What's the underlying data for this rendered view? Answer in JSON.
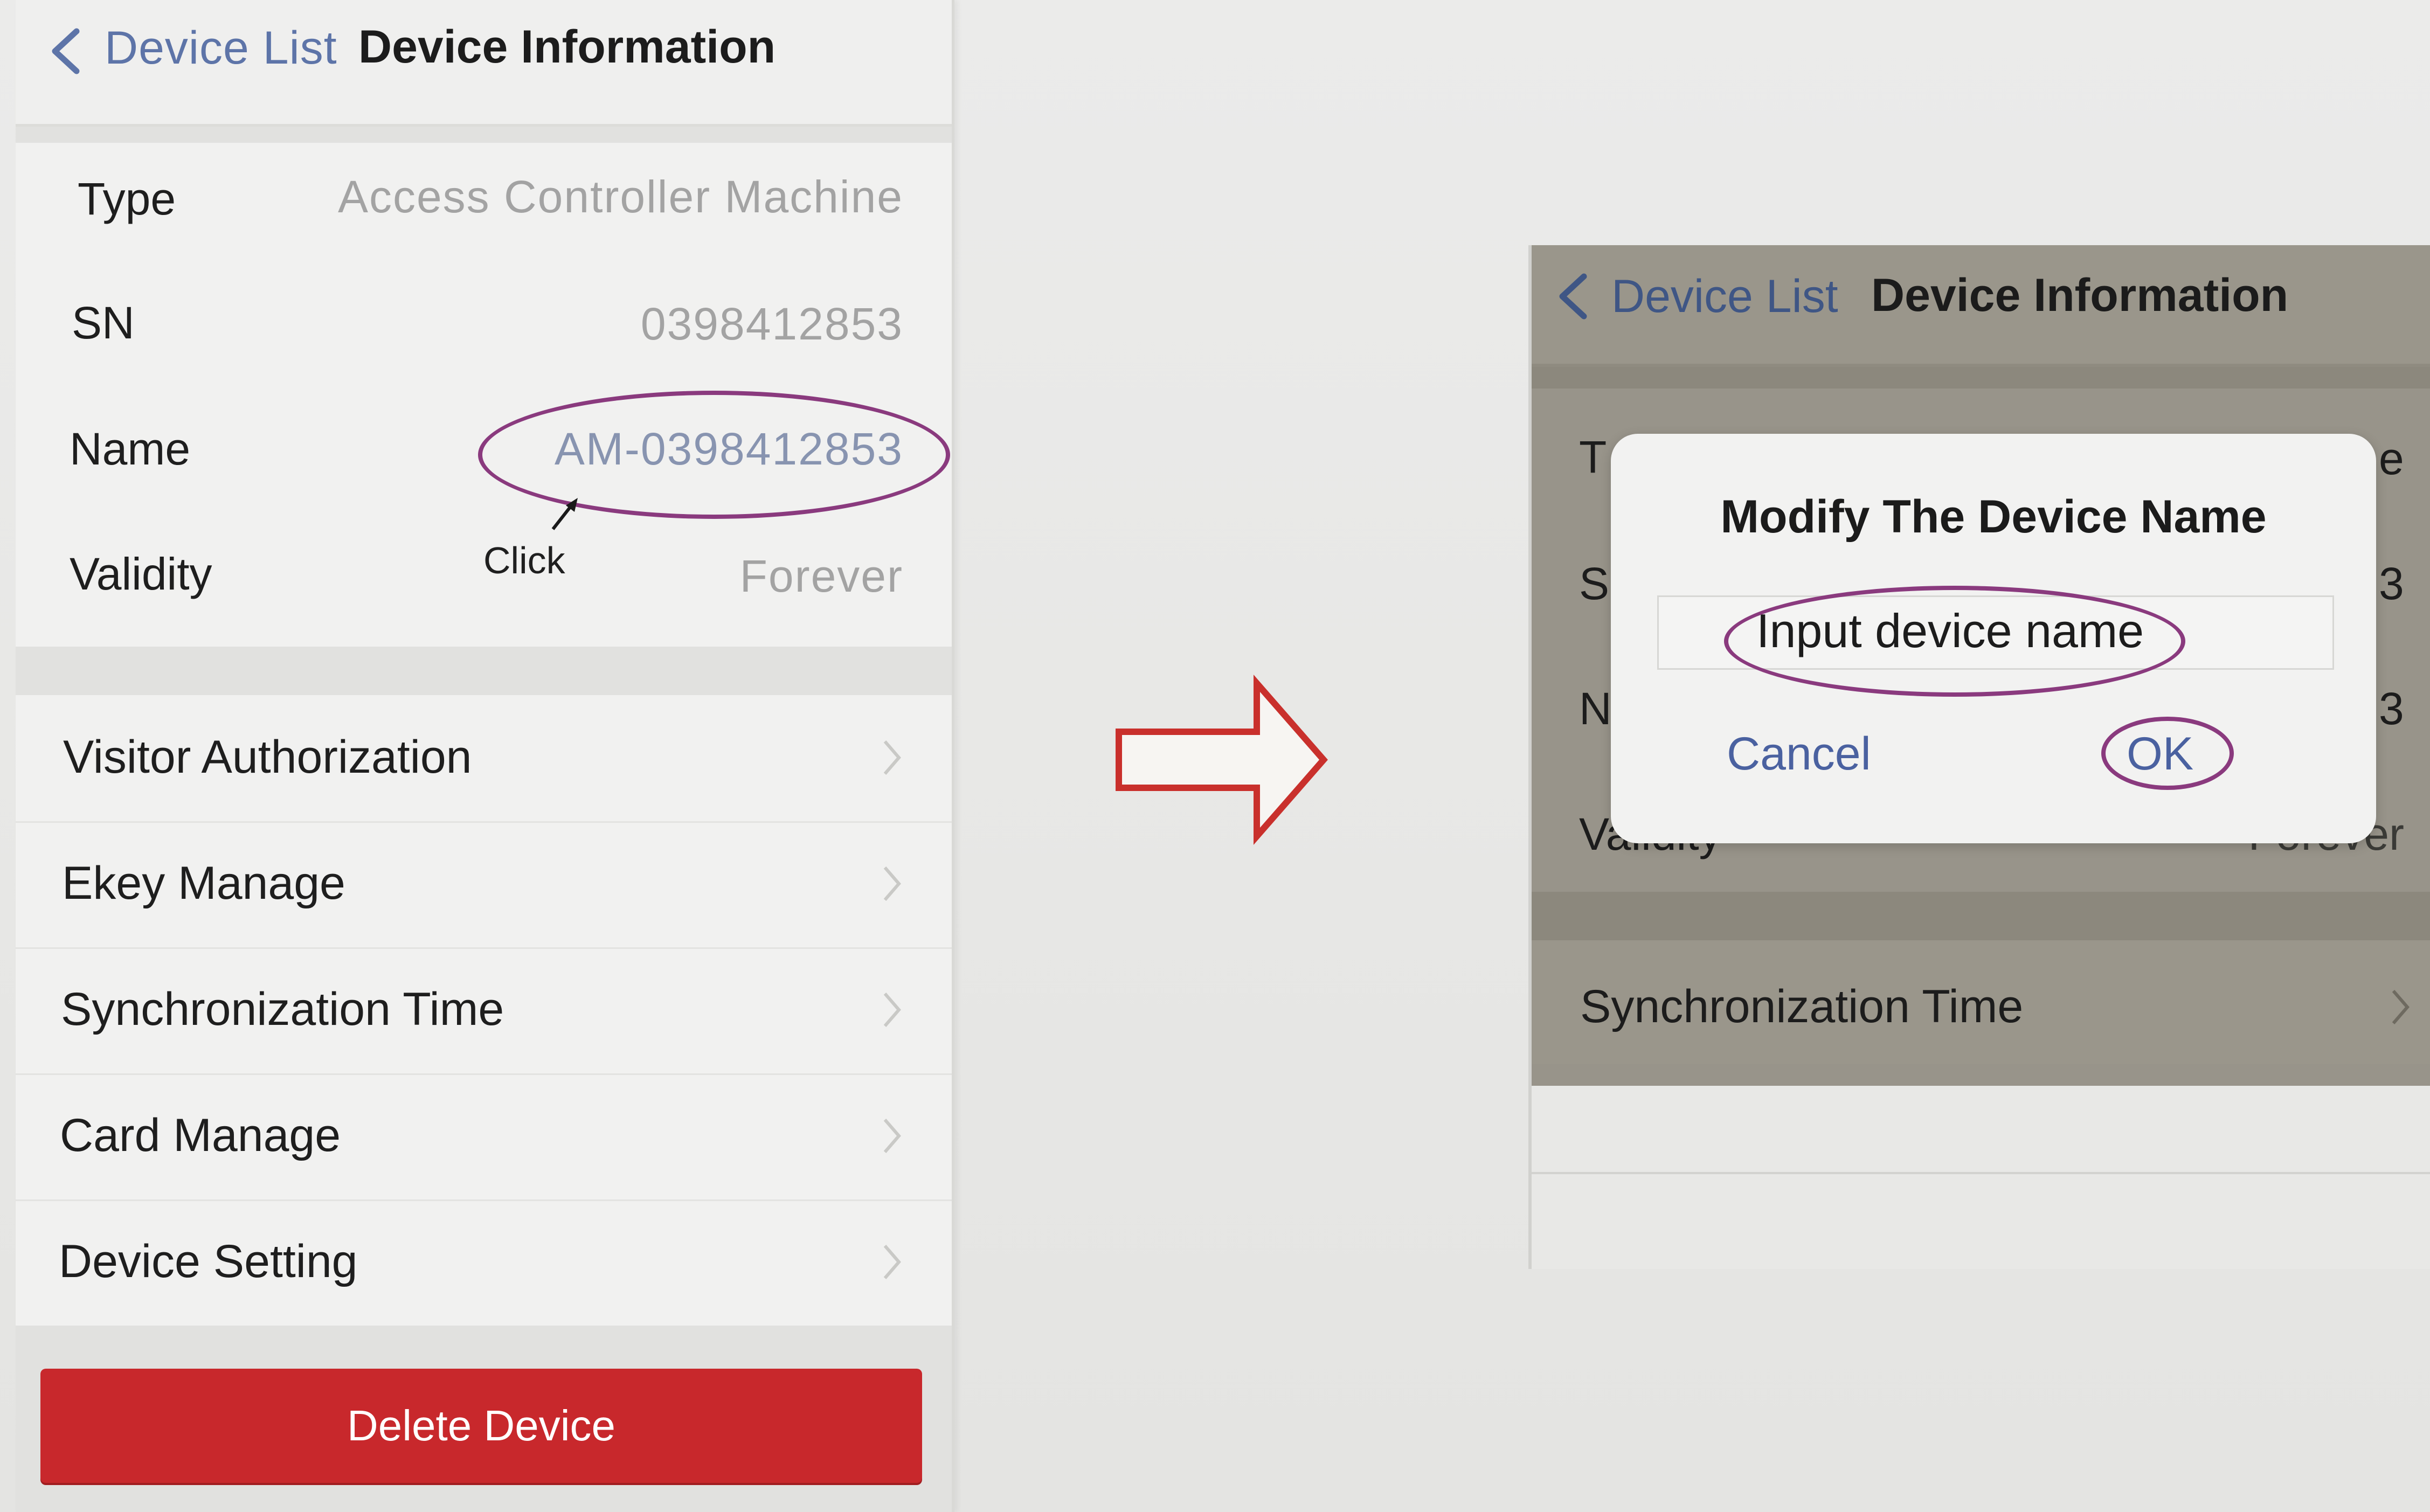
{
  "left_screen": {
    "nav": {
      "back_label": "Device List",
      "title": "Device Information"
    },
    "info_rows": [
      {
        "label": "Type",
        "value": "Access Controller Machine"
      },
      {
        "label": "SN",
        "value": "0398412853"
      },
      {
        "label": "Name",
        "value": "AM-0398412853"
      },
      {
        "label": "Validity",
        "value": "Forever"
      }
    ],
    "click_note": "Click",
    "menu_items": [
      {
        "label": "Visitor Authorization"
      },
      {
        "label": "Ekey Manage"
      },
      {
        "label": "Synchronization Time"
      },
      {
        "label": "Card Manage"
      },
      {
        "label": "Device Setting"
      }
    ],
    "delete_button": "Delete Device"
  },
  "right_screen": {
    "nav": {
      "back_label": "Device List",
      "title": "Device Information"
    },
    "partial_row_glyphs": {
      "type_left": "T",
      "type_right": "e",
      "sn_left": "S",
      "sn_right": "3",
      "name_left": "N",
      "name_right": "3",
      "validity_label": "Validity",
      "validity_value": "Forever"
    },
    "sync_item": "Synchronization Time",
    "dialog": {
      "title": "Modify The Device Name",
      "input_placeholder": "Input device name",
      "cancel": "Cancel",
      "ok": "OK"
    }
  },
  "colors": {
    "link_blue": "#5d74a8",
    "delete_red": "#c8282c",
    "annotation_purple": "#8a3a7e",
    "arrow_red": "#c9302c"
  }
}
